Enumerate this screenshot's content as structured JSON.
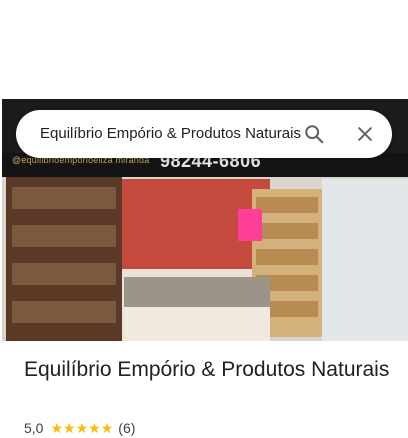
{
  "search": {
    "query": "Equilíbrio Empório & Produtos Naturais",
    "search_icon": "search-icon",
    "close_icon": "close-icon"
  },
  "photo": {
    "instagram_handle": "@equilibrioemporioeliza miranda",
    "phone": "98244-6806"
  },
  "place": {
    "name": "Equilíbrio Empório & Produtos Naturais",
    "rating_value": "5,0",
    "stars": 5,
    "review_count": "(6)"
  },
  "colors": {
    "star": "#fbbc04",
    "text_primary": "#202124",
    "text_secondary": "#3c4043"
  }
}
